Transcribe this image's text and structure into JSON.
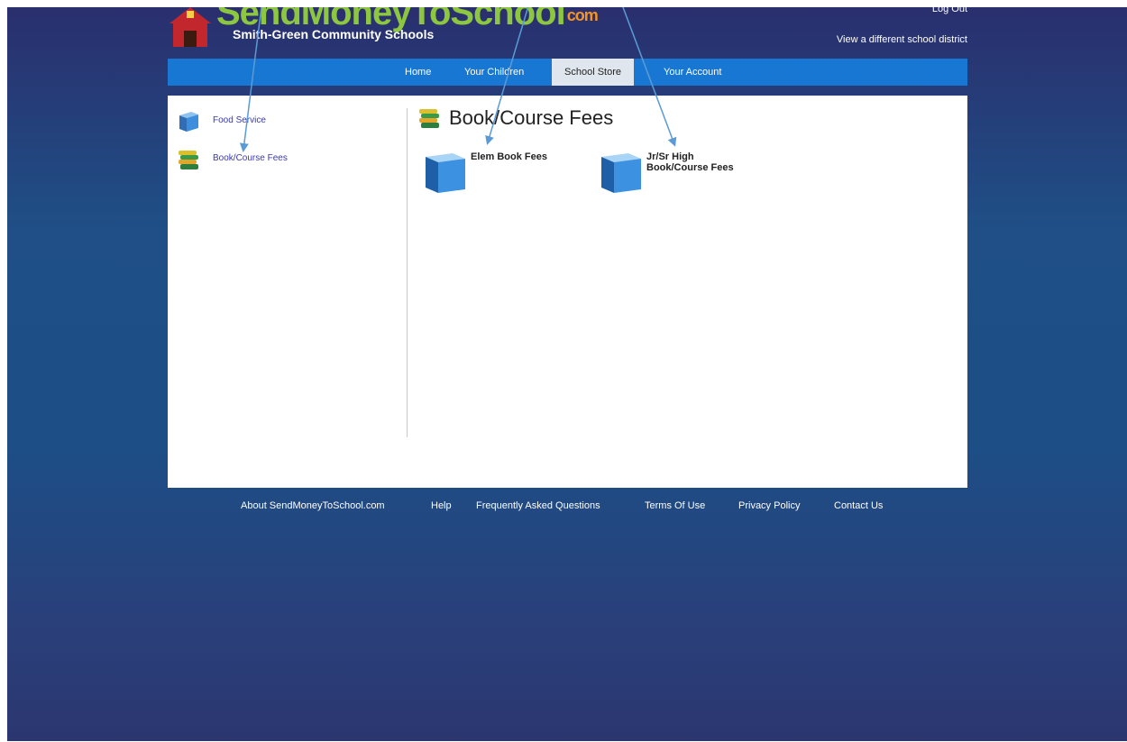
{
  "header": {
    "logo_text": "SendMoneyToSchool",
    "logo_suffix": "com",
    "district_name": "Smith-Green Community Schools",
    "logout": "Log Out",
    "change_district": "View a different school district"
  },
  "nav": {
    "items": [
      {
        "label": "Home"
      },
      {
        "label": "Your Children"
      },
      {
        "label": "School Store",
        "active": true
      },
      {
        "label": "Your Account"
      }
    ]
  },
  "sidebar": {
    "items": [
      {
        "label": "Food Service",
        "icon": "blue-cube-icon"
      },
      {
        "label": "Book/Course Fees",
        "icon": "books-icon"
      }
    ]
  },
  "main": {
    "title": "Book/Course Fees",
    "title_icon": "books-icon",
    "products": [
      {
        "name_line1": "Elem Book Fees",
        "name_line2": "",
        "icon": "blue-cube-icon"
      },
      {
        "name_line1": "Jr/Sr High",
        "name_line2": "Book/Course Fees",
        "icon": "blue-cube-icon"
      }
    ]
  },
  "footer": {
    "links": [
      {
        "label": "About SendMoneyToSchool.com"
      },
      {
        "label": "Help"
      },
      {
        "label": "Frequently Asked Questions"
      },
      {
        "label": "Terms Of Use"
      },
      {
        "label": "Privacy Policy"
      },
      {
        "label": "Contact Us"
      }
    ]
  },
  "colors": {
    "nav_bar": "#1877d2",
    "logo_green": "#8dc63f",
    "link_blue": "#3a3aa8",
    "annotation_arrow": "#5b9bd5"
  }
}
